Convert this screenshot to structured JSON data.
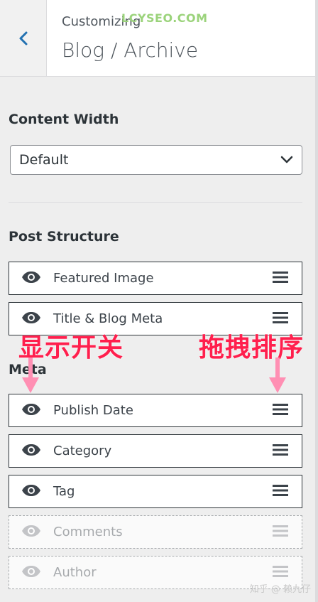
{
  "header": {
    "back_icon": "chevron-left-icon",
    "subtitle": "Customizing",
    "title": "Blog / Archive",
    "watermark": "LCYSEO.COM"
  },
  "content_width": {
    "label": "Content Width",
    "selected": "Default",
    "dropdown_icon": "chevron-down-icon"
  },
  "post_structure": {
    "label": "Post Structure",
    "items": [
      {
        "label": "Featured Image",
        "enabled": true
      },
      {
        "label": "Title & Blog Meta",
        "enabled": true
      }
    ]
  },
  "meta": {
    "label": "Meta",
    "items": [
      {
        "label": "Publish Date",
        "enabled": true
      },
      {
        "label": "Category",
        "enabled": true
      },
      {
        "label": "Tag",
        "enabled": true
      },
      {
        "label": "Comments",
        "enabled": false
      },
      {
        "label": "Author",
        "enabled": false
      }
    ]
  },
  "annotations": {
    "toggle_note": "显示开关",
    "drag_note": "拖拽排序",
    "color": "#ff1f4d",
    "arrow_color": "#ff8fb3"
  },
  "footer_watermark": "知乎 @ 赖九仔"
}
